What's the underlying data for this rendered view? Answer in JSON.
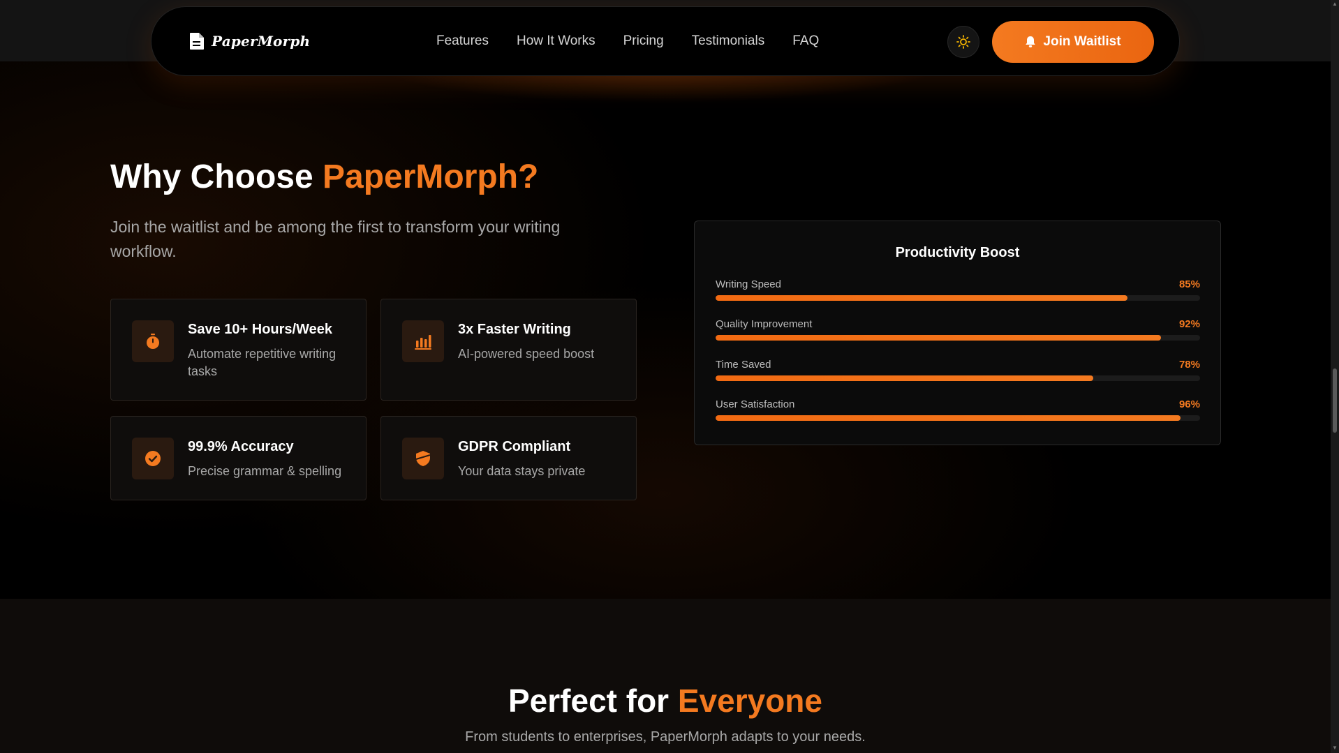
{
  "brand": {
    "name": "PaperMorph"
  },
  "nav": {
    "links": [
      "Features",
      "How It Works",
      "Pricing",
      "Testimonials",
      "FAQ"
    ],
    "theme_toggle_icon": "sun-icon",
    "cta": "Join Waitlist",
    "cta_icon": "bell-icon"
  },
  "why": {
    "title_prefix": "Why Choose ",
    "title_accent": "PaperMorph?",
    "subtitle": "Join the waitlist and be among the first to transform your writing workflow.",
    "cards": [
      {
        "icon": "stopwatch-icon",
        "title": "Save 10+ Hours/Week",
        "desc": "Automate repetitive writing tasks"
      },
      {
        "icon": "bar-chart-icon",
        "title": "3x Faster Writing",
        "desc": "AI-powered speed boost"
      },
      {
        "icon": "check-circle-icon",
        "title": "99.9% Accuracy",
        "desc": "Precise grammar & spelling"
      },
      {
        "icon": "shield-icon",
        "title": "GDPR Compliant",
        "desc": "Your data stays private"
      }
    ]
  },
  "productivity": {
    "title": "Productivity Boost",
    "metrics": [
      {
        "label": "Writing Speed",
        "value_text": "85%",
        "value": 85
      },
      {
        "label": "Quality Improvement",
        "value_text": "92%",
        "value": 92
      },
      {
        "label": "Time Saved",
        "value_text": "78%",
        "value": 78
      },
      {
        "label": "User Satisfaction",
        "value_text": "96%",
        "value": 96
      }
    ]
  },
  "everyone": {
    "title_prefix": "Perfect for ",
    "title_accent": "Everyone",
    "subtitle": "From students to enterprises, PaperMorph adapts to your needs."
  },
  "colors": {
    "accent": "#f47a20",
    "background": "#000000"
  }
}
